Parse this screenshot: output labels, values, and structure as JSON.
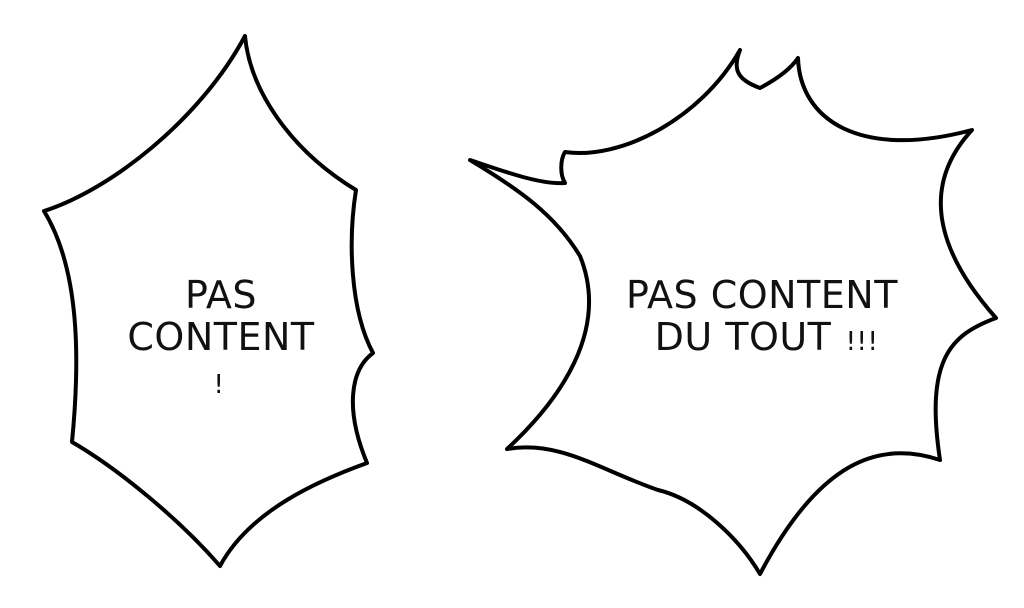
{
  "left_bubble": {
    "line1": "PAS",
    "line2": "CONTENT",
    "line3": "!"
  },
  "right_bubble": {
    "line1": "PAS CONTENT",
    "line2": "DU TOUT",
    "exclaim": "!!!"
  },
  "colors": {
    "stroke": "#000000",
    "fill": "#ffffff",
    "text": "#111111"
  }
}
